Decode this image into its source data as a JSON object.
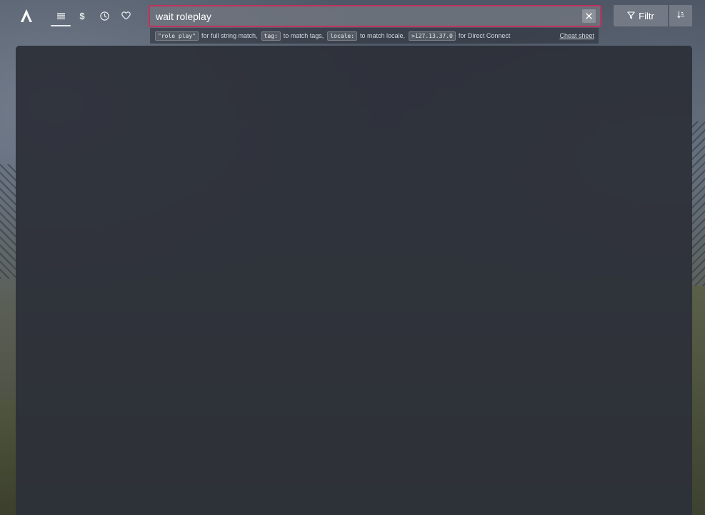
{
  "app": {
    "logo_icon": "triangle-a-logo-icon"
  },
  "nav": {
    "tabs": [
      {
        "name": "all-servers",
        "icon": "list-icon",
        "active": true
      },
      {
        "name": "premium",
        "icon": "dollar-icon",
        "glyph": "$",
        "active": false
      },
      {
        "name": "history",
        "icon": "clock-icon",
        "active": false
      },
      {
        "name": "favorites",
        "icon": "heart-icon",
        "active": false
      }
    ]
  },
  "search": {
    "value": "wait roleplay",
    "accent_color": "#c2315c",
    "clear_icon": "close-icon"
  },
  "hints": {
    "items": [
      {
        "code": "\"role play\"",
        "text": "for full string match,"
      },
      {
        "code": "tag:",
        "text": "to match tags,"
      },
      {
        "code": "locale:",
        "text": "to match locale,"
      },
      {
        "code": ">127.13.37.0",
        "text": "for Direct Connect"
      }
    ],
    "cheat_sheet_label": "Cheat sheet"
  },
  "toolbar": {
    "filter_label": "Filtr",
    "filter_icon": "funnel-icon",
    "sort_icon": "sort-icon"
  }
}
